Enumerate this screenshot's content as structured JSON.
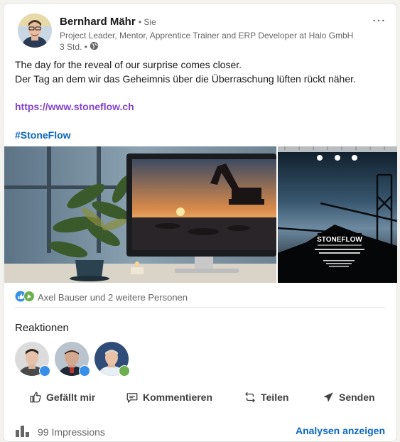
{
  "post": {
    "author": {
      "name": "Bernhard Mähr",
      "relation": "• Sie",
      "headline": "Project Leader, Mentor, Apprentice Trainer and ERP Developer at Halo GmbH",
      "time": "3 Std. •",
      "visibility_icon": "globe-icon"
    },
    "more_icon": "…",
    "text_lines": [
      "The day for the reveal of our surprise comes closer.",
      "Der Tag an dem wir das Geheimnis über die Überraschung lüften rückt näher."
    ],
    "link": "https://www.stoneflow.ch",
    "hashtag": "#StoneFlow",
    "images": {
      "left": "computer-monitor-with-excavator-sunset-photo",
      "right": {
        "logo": "STONEFLOW",
        "tagline": "DIGITALE TRANSFORMATION FÜR DIE STEIN- UND ERDENINDUSTRIE"
      }
    }
  },
  "social": {
    "reaction_icons": [
      "like-icon",
      "celebrate-icon"
    ],
    "summary": "Axel Bauser und 2 weitere Personen"
  },
  "reactions": {
    "title": "Reaktionen",
    "reactors": [
      {
        "name": "reactor-1",
        "badge": "like-icon",
        "badge_color": "#378fe9"
      },
      {
        "name": "reactor-2",
        "badge": "like-icon",
        "badge_color": "#378fe9"
      },
      {
        "name": "reactor-3",
        "badge": "celebrate-icon",
        "badge_color": "#6dae4f"
      }
    ]
  },
  "actions": {
    "like": "Gefällt mir",
    "comment": "Kommentieren",
    "share": "Teilen",
    "send": "Senden"
  },
  "footer": {
    "impressions": "99 Impressions",
    "analytics": "Analysen anzeigen"
  },
  "colors": {
    "link_purple": "#8344cc",
    "brand_blue": "#0a66c2",
    "text_secondary": "#666666"
  }
}
